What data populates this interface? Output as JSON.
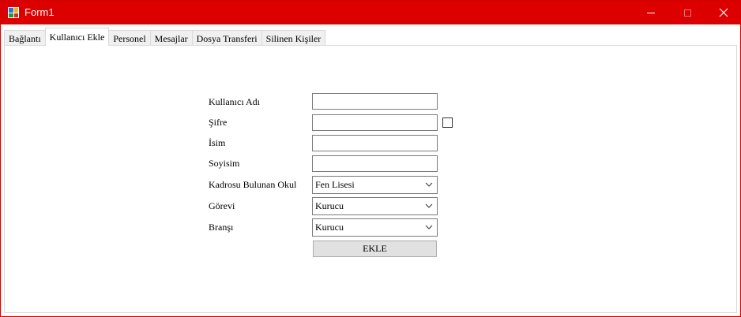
{
  "window": {
    "title": "Form1"
  },
  "tabs": [
    {
      "label": "Bağlantı"
    },
    {
      "label": "Kullanıcı Ekle",
      "active": true
    },
    {
      "label": "Personel"
    },
    {
      "label": "Mesajlar"
    },
    {
      "label": "Dosya Transferi"
    },
    {
      "label": "Silinen Kişiler"
    }
  ],
  "form": {
    "username_label": "Kullanıcı Adı",
    "username_value": "",
    "password_label": "Şifre",
    "password_value": "",
    "show_password_checked": false,
    "name_label": "İsim",
    "name_value": "",
    "surname_label": "Soyisim",
    "surname_value": "",
    "school_label": "Kadrosu Bulunan Okul",
    "school_value": "Fen Lisesi",
    "role_label": "Görevi",
    "role_value": "Kurucu",
    "branch_label": "Branşı",
    "branch_value": "Kurucu",
    "submit_label": "EKLE"
  },
  "colors": {
    "titlebar": "#dc0000",
    "window_border": "#d40000"
  }
}
